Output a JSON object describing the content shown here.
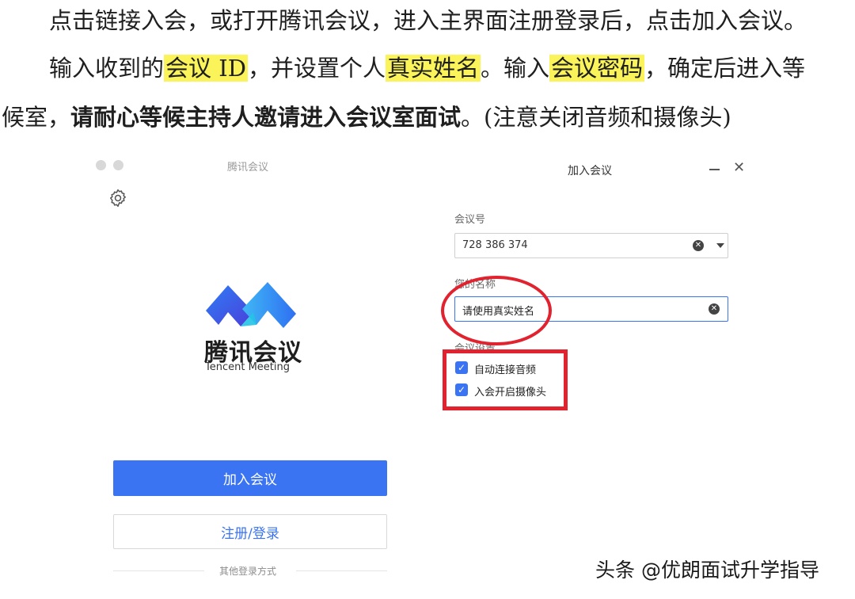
{
  "instructions": {
    "line1": "点击链接入会，或打开腾讯会议，进入主界面注册登录后，点击加入会议。",
    "line2_a": "输入收到的",
    "line2_hl1": "会议 ID",
    "line2_b": "，并设置个人",
    "line2_hl2": "真实姓名",
    "line2_c": "。输入",
    "line2_hl3": "会议密码",
    "line2_d": "，确定后进入等",
    "line3_a": "候室，",
    "line3_bold": "请耐心等候主持人邀请进入会议室面试",
    "line3_b": "。(注意关闭音频和摄像头)",
    "highlight_color": "#fbf35a"
  },
  "app": {
    "title": "腾讯会议",
    "brand_cn": "腾讯会议",
    "brand_en": "Tencent Meeting",
    "join_button": "加入会议",
    "login_button": "注册/登录",
    "other_login": "其他登录方式",
    "accent": "#3a74f2"
  },
  "dialog": {
    "title": "加入会议",
    "meeting_id_label": "会议号",
    "meeting_id_value": "728  386  374",
    "name_label": "您的名称",
    "name_placeholder": "请使用真实姓名",
    "settings_label": "会议设置",
    "opt_audio": "自动连接音频",
    "opt_video": "入会开启摄像头",
    "opt_audio_checked": true,
    "opt_video_checked": true
  },
  "annotation_color": "#e0232f",
  "watermark": "头条 @优朗面试升学指导"
}
